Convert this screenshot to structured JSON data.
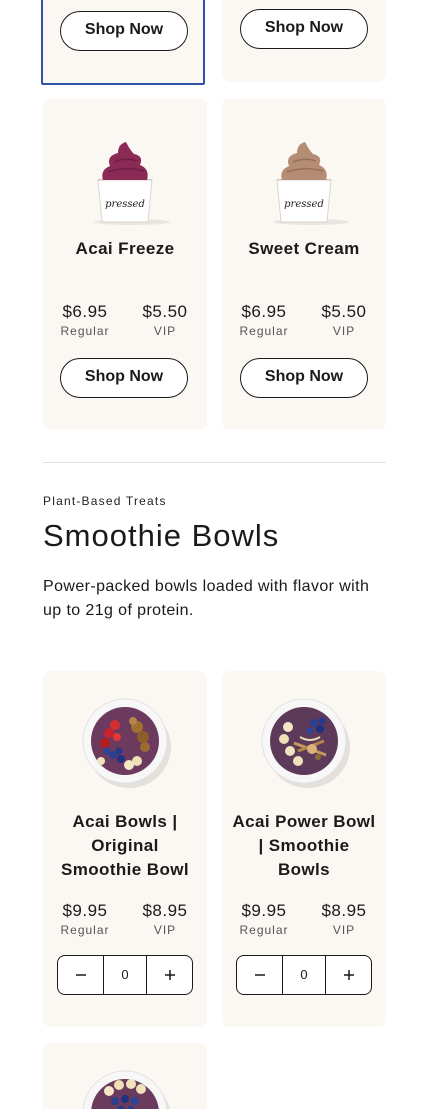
{
  "top_row": {
    "left_button": "Shop Now",
    "right_button": "Shop Now"
  },
  "freeze_products": [
    {
      "name": "Acai Freeze",
      "cup_text": "pressed",
      "price_regular": "$6.95",
      "regular_label": "Regular",
      "price_vip": "$5.50",
      "vip_label": "VIP",
      "button": "Shop Now",
      "swirl_color": "#8a2a55"
    },
    {
      "name": "Sweet Cream",
      "cup_text": "pressed",
      "price_regular": "$6.95",
      "regular_label": "Regular",
      "price_vip": "$5.50",
      "vip_label": "VIP",
      "button": "Shop Now",
      "swirl_color": "#b58d74"
    }
  ],
  "section": {
    "eyebrow": "Plant-Based Treats",
    "title": "Smoothie Bowls",
    "description": "Power-packed bowls loaded with flavor with up to 21g of protein."
  },
  "bowl_products": [
    {
      "name": "Acai Bowls | Original Smoothie Bowl",
      "price_regular": "$9.95",
      "regular_label": "Regular",
      "price_vip": "$8.95",
      "vip_label": "VIP",
      "quantity": "0"
    },
    {
      "name": "Acai Power Bowl | Smoothie Bowls",
      "price_regular": "$9.95",
      "regular_label": "Regular",
      "price_vip": "$8.95",
      "vip_label": "VIP",
      "quantity": "0"
    }
  ],
  "icons": {
    "decrement": "minus-icon",
    "increment": "plus-icon"
  },
  "colors": {
    "card_bg": "#fbf8f4",
    "selected_border": "#2f52a8",
    "text": "#1a1a1a"
  }
}
